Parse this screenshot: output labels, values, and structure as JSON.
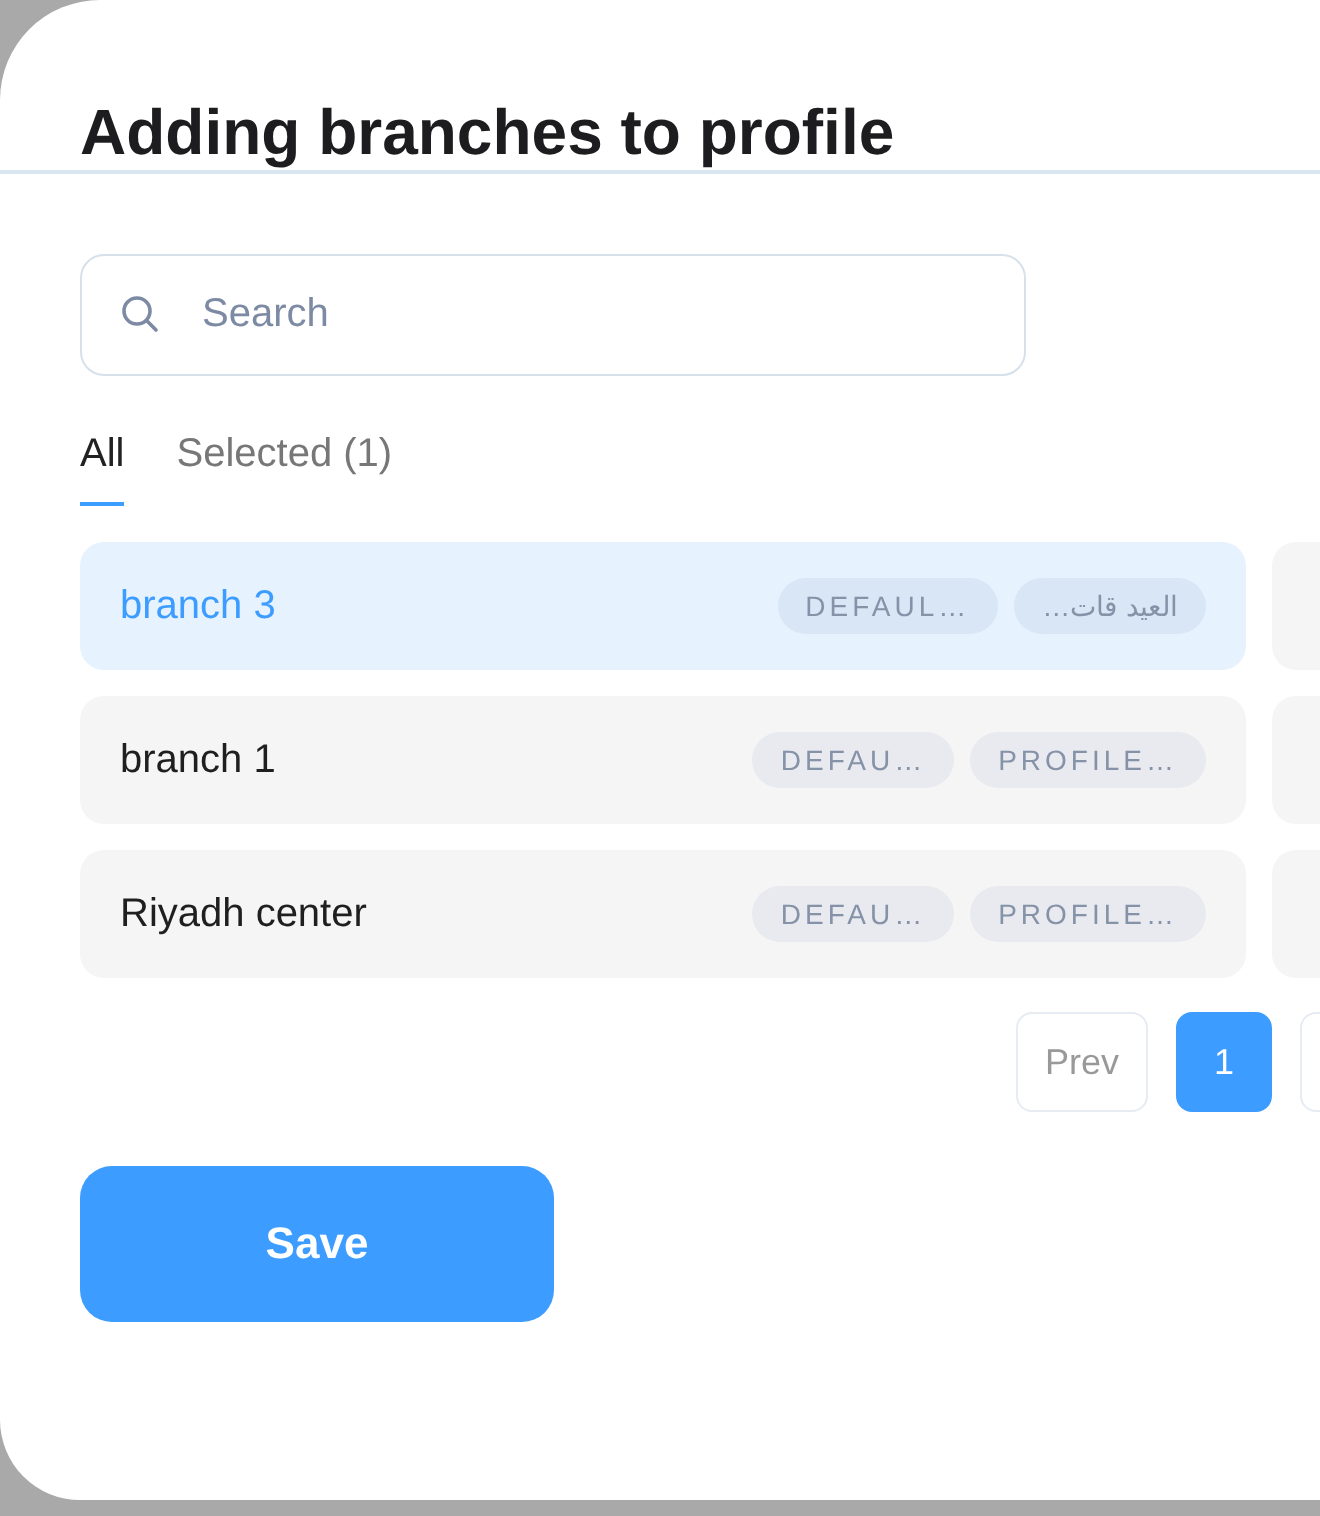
{
  "title": "Adding branches to profile",
  "search": {
    "placeholder": "Search"
  },
  "tabs": [
    {
      "label": "All",
      "selected": true
    },
    {
      "label": "Selected (1)",
      "selected": false
    }
  ],
  "branches": [
    {
      "name": "branch 3",
      "selected": true,
      "tags": [
        "DEFAUL…",
        "العيد قات…"
      ]
    },
    {
      "name": "branch 1",
      "selected": false,
      "tags": [
        "DEFAU…",
        "PROFILE…"
      ]
    },
    {
      "name": "Riyadh center",
      "selected": false,
      "tags": [
        "DEFAU…",
        "PROFILE…"
      ]
    }
  ],
  "pagination": {
    "prev": "Prev",
    "pages": [
      {
        "label": "1",
        "selected": true
      }
    ]
  },
  "save": "Save"
}
